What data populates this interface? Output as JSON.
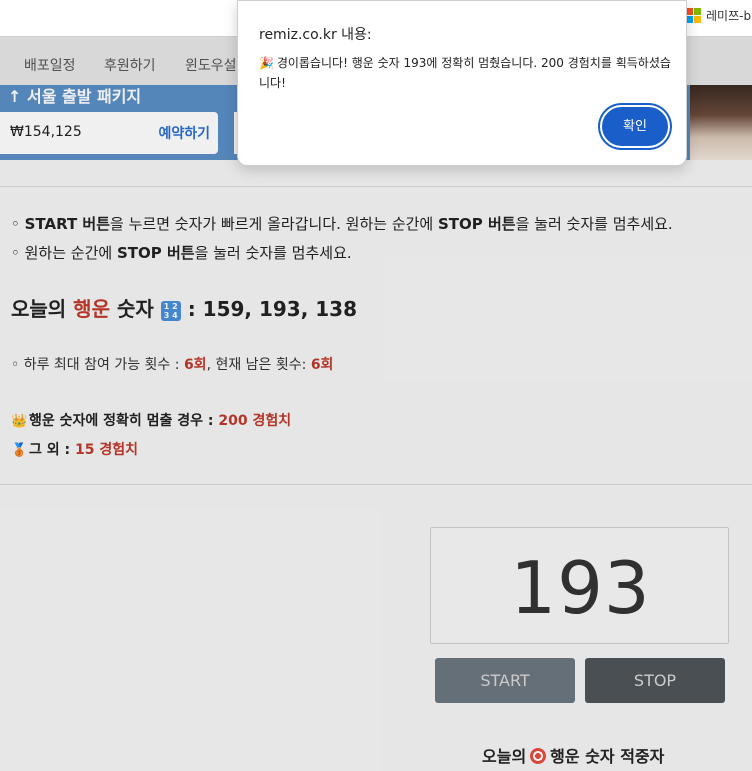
{
  "browser": {
    "ms_label": "레미쯔-b"
  },
  "nav": {
    "items": [
      "배포일정",
      "후원하기",
      "윈도우설"
    ]
  },
  "ad": {
    "title": "↑ 서울 출발 패키지",
    "price": "₩154,125",
    "book_label": "예약하기"
  },
  "rules": {
    "line1_pre": "◦ ",
    "line1_b1": "START 버튼",
    "line1_mid": "을 누르면 숫자가 빠르게 올라갑니다. 원하는 순간에 ",
    "line1_b2": "STOP 버튼",
    "line1_post": "을 눌러 숫자를 멈추세요.",
    "line2_pre": "◦ 원하는 순간에 ",
    "line2_b": "STOP 버튼",
    "line2_post": "을 눌러 숫자를 멈추세요."
  },
  "lucky": {
    "prefix": "오늘의 ",
    "highlight": "행운",
    "suffix": " 숫자 ",
    "icon_text": "1 2\n3 4",
    "numbers": ": 159, 193, 138"
  },
  "limits": {
    "label": "◦ 하루 최대 참여 가능 횟수 : ",
    "max": "6회",
    "sep": ", 현재 남은 횟수: ",
    "remaining": "6회"
  },
  "rewards": {
    "exact_label": "행운 숫자에 정확히 멈출 경우 : ",
    "exact_value": "200 경험치",
    "other_label": "그 외 : ",
    "other_value": "15 경험치"
  },
  "game": {
    "display_number": "193",
    "start_label": "START",
    "stop_label": "STOP"
  },
  "winners": {
    "prefix": "오늘의",
    "suffix": "행운 숫자 적중자"
  },
  "dialog": {
    "origin": "remiz.co.kr 내용:",
    "message": "경이롭습니다! 행운 숫자 193에 정확히 멈췄습니다. 200 경험치를 획득하셨습니다!",
    "ok_label": "확인"
  }
}
